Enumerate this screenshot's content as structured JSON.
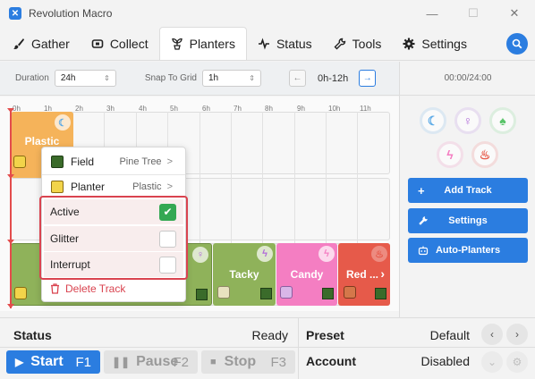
{
  "window": {
    "title": "Revolution Macro",
    "minimize": "—",
    "maximize": "☐",
    "close": "✕"
  },
  "tabs": [
    {
      "label": "Gather",
      "icon": "brush-icon"
    },
    {
      "label": "Collect",
      "icon": "collect-icon"
    },
    {
      "label": "Planters",
      "icon": "planters-icon",
      "active": true
    },
    {
      "label": "Status",
      "icon": "pulse-icon"
    },
    {
      "label": "Tools",
      "icon": "wrench-icon"
    },
    {
      "label": "Settings",
      "icon": "gear-icon"
    }
  ],
  "toolbar": {
    "duration_label": "Duration",
    "duration_value": "24h",
    "snap_label": "Snap To Grid",
    "snap_value": "1h",
    "range_label": "0h-12h",
    "prev": "←",
    "next": "→"
  },
  "timeline": {
    "hours": [
      "0h",
      "1h",
      "2h",
      "3h",
      "4h",
      "5h",
      "6h",
      "7h",
      "8h",
      "9h",
      "10h",
      "11h"
    ],
    "blocks": {
      "plastic": "Plastic",
      "tacky": "Tacky",
      "candy": "Candy",
      "red": "Red ..."
    },
    "next_arrow": "›"
  },
  "menu": {
    "field_label": "Field",
    "field_value": "Pine Tree",
    "planter_label": "Planter",
    "planter_value": "Plastic",
    "active_label": "Active",
    "glitter_label": "Glitter",
    "interrupt_label": "Interrupt",
    "active_checked": true,
    "glitter_checked": false,
    "interrupt_checked": false,
    "delete_label": "Delete Track",
    "chevron": ">"
  },
  "sidebar": {
    "timecode": "00:00/24:00",
    "add_track": "Add Track",
    "settings": "Settings",
    "auto_planters": "Auto-Planters"
  },
  "status": {
    "status_label": "Status",
    "status_value": "Ready",
    "preset_label": "Preset",
    "preset_value": "Default",
    "account_label": "Account",
    "account_value": "Disabled",
    "start_label": "Start",
    "start_key": "F1",
    "pause_label": "Pause",
    "pause_key": "F2",
    "stop_label": "Stop",
    "stop_key": "F3"
  },
  "colors": {
    "accent": "#2b7de0",
    "plastic": "#f5b35a",
    "green_track": "#7ba850",
    "tacky": "#8fb25a",
    "candy": "#f47ec2",
    "red": "#e65a4a",
    "danger": "#d9434f"
  }
}
